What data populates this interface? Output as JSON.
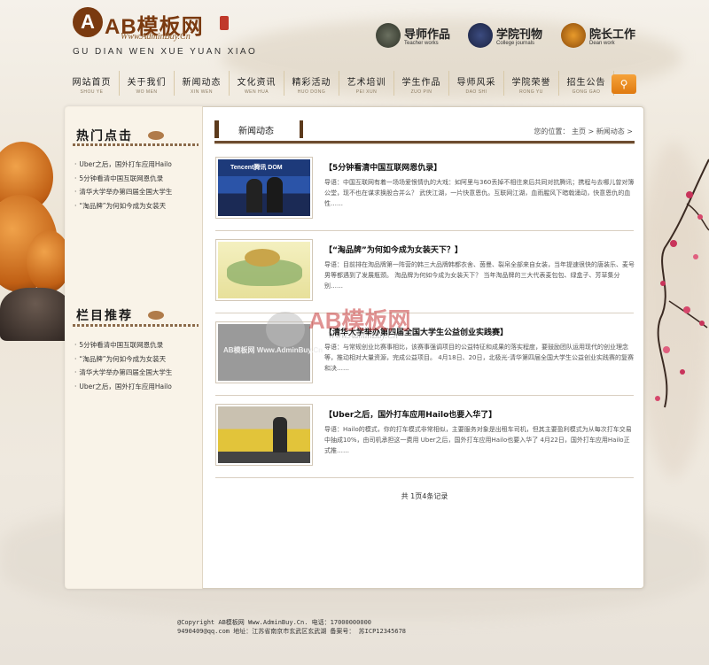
{
  "site": {
    "logo_text": "AB模板网",
    "logo_url": "Www.AdminBuy.Cn",
    "pinyin": "GU DIAN WEN XUE YUAN XIAO"
  },
  "quick_links": [
    {
      "title": "导师作品",
      "subtitle": "Teacher works",
      "icon": "teacher-works-icon"
    },
    {
      "title": "学院刊物",
      "subtitle": "College journals",
      "icon": "journal-book-icon"
    },
    {
      "title": "院长工作",
      "subtitle": "Dean work",
      "icon": "dean-work-icon"
    }
  ],
  "nav": [
    {
      "label": "网站首页",
      "pinyin": "SHOU YE"
    },
    {
      "label": "关于我们",
      "pinyin": "WO MEN"
    },
    {
      "label": "新闻动态",
      "pinyin": "XIN WEN"
    },
    {
      "label": "文化资讯",
      "pinyin": "WEN HUA"
    },
    {
      "label": "精彩活动",
      "pinyin": "HUO DONG"
    },
    {
      "label": "艺术培训",
      "pinyin": "PEI XUN"
    },
    {
      "label": "学生作品",
      "pinyin": "ZUO PIN"
    },
    {
      "label": "导师风采",
      "pinyin": "DAO SHI"
    },
    {
      "label": "学院荣誉",
      "pinyin": "RONG YU"
    },
    {
      "label": "招生公告",
      "pinyin": "GONG GAO"
    }
  ],
  "sidebar": {
    "hot_title": "热门点击",
    "hot_items": [
      "Uber之后，国外打车应用Hailo",
      "5分钟看清中国互联网恩仇录",
      "清华大学举办第四届全国大学生",
      "“淘品牌”为何如今成为女装天"
    ],
    "recommend_title": "栏目推荐",
    "recommend_items": [
      "5分钟看清中国互联网恩仇录",
      "“淘品牌”为何如今成为女装天",
      "清华大学举办第四届全国大学生",
      "Uber之后，国外打车应用Hailo"
    ]
  },
  "main": {
    "section_title": "新闻动态",
    "location": "您的位置：  主页  >  新闻动态  >",
    "articles": [
      {
        "title": "【5分钟看清中国互联网恩仇录】",
        "summary": "导语：中国互联网有着一场场爱恨情仇的大戏：如阿里与360丢掉不相往来后共同对抗腾讯；携程与去哪儿曾对簿公堂，现不也在谋求换股合并么？ 武侠江湖，一片快意恩仇。互联网江湖，血雨腥风下暗戟涌动，快意恩仇的血性……",
        "thumb_text": "Tencent腾讯  DOM"
      },
      {
        "title": "【“淘品牌”为何如今成为女装天下？】",
        "summary": "导语：目前排在淘品牌第一阵营的韩三大品牌韩都衣舍、茵曼、裂帛全部来自女装，当年提速很快的唐装乐、麦号男等都遇到了发展瓶颈。 淘品牌为何如今成为女装天下？ 当年淘品牌的三大代表麦包包、绿盒子、芳草集分别……",
        "thumb_text": ""
      },
      {
        "title": "【清华大学举办第四届全国大学生公益创业实践赛】",
        "summary": "导语：与常规创业比赛事相比，该赛事强调项目的公益特征和成果的落实程度，要鼓励团队运用现代的创业理念等，推动相对大量资源，完成公益项目。 4月18日、20日，北极光-清华第四届全国大学生公益创业实践赛的复赛和决……",
        "thumb_text": "AB模板网 Www.AdminBuy.Cn"
      },
      {
        "title": "【Uber之后，国外打车应用Hailo也要入华了】",
        "summary": "导语：Hailo的模式，你的打车模式非常相似，主要服务对象是出租车司机，但其主要盈利模式为从每次打车交易中抽成10%，由司机承担这一费用 Uber之后，国外打车应用Hailo也要入华了 4月22日，国外打车应用Hailo正式推……",
        "thumb_text": ""
      }
    ],
    "pager": "共 1页4条记录"
  },
  "watermark": {
    "text": "AB模板网",
    "url": "Www.AdminBuy.Cn"
  },
  "footer": {
    "line1": "@Copyright AB模板网 Www.AdminBuy.Cn. 电话：17000000000",
    "line2": "9490409@qq.com     地址：江苏省南京市玄武区玄武湖   备案号：  苏ICP12345678"
  },
  "colors": {
    "brand_brown": "#7a3a10",
    "accent_orange": "#e07a10",
    "title_bar": "#6d4c30"
  }
}
